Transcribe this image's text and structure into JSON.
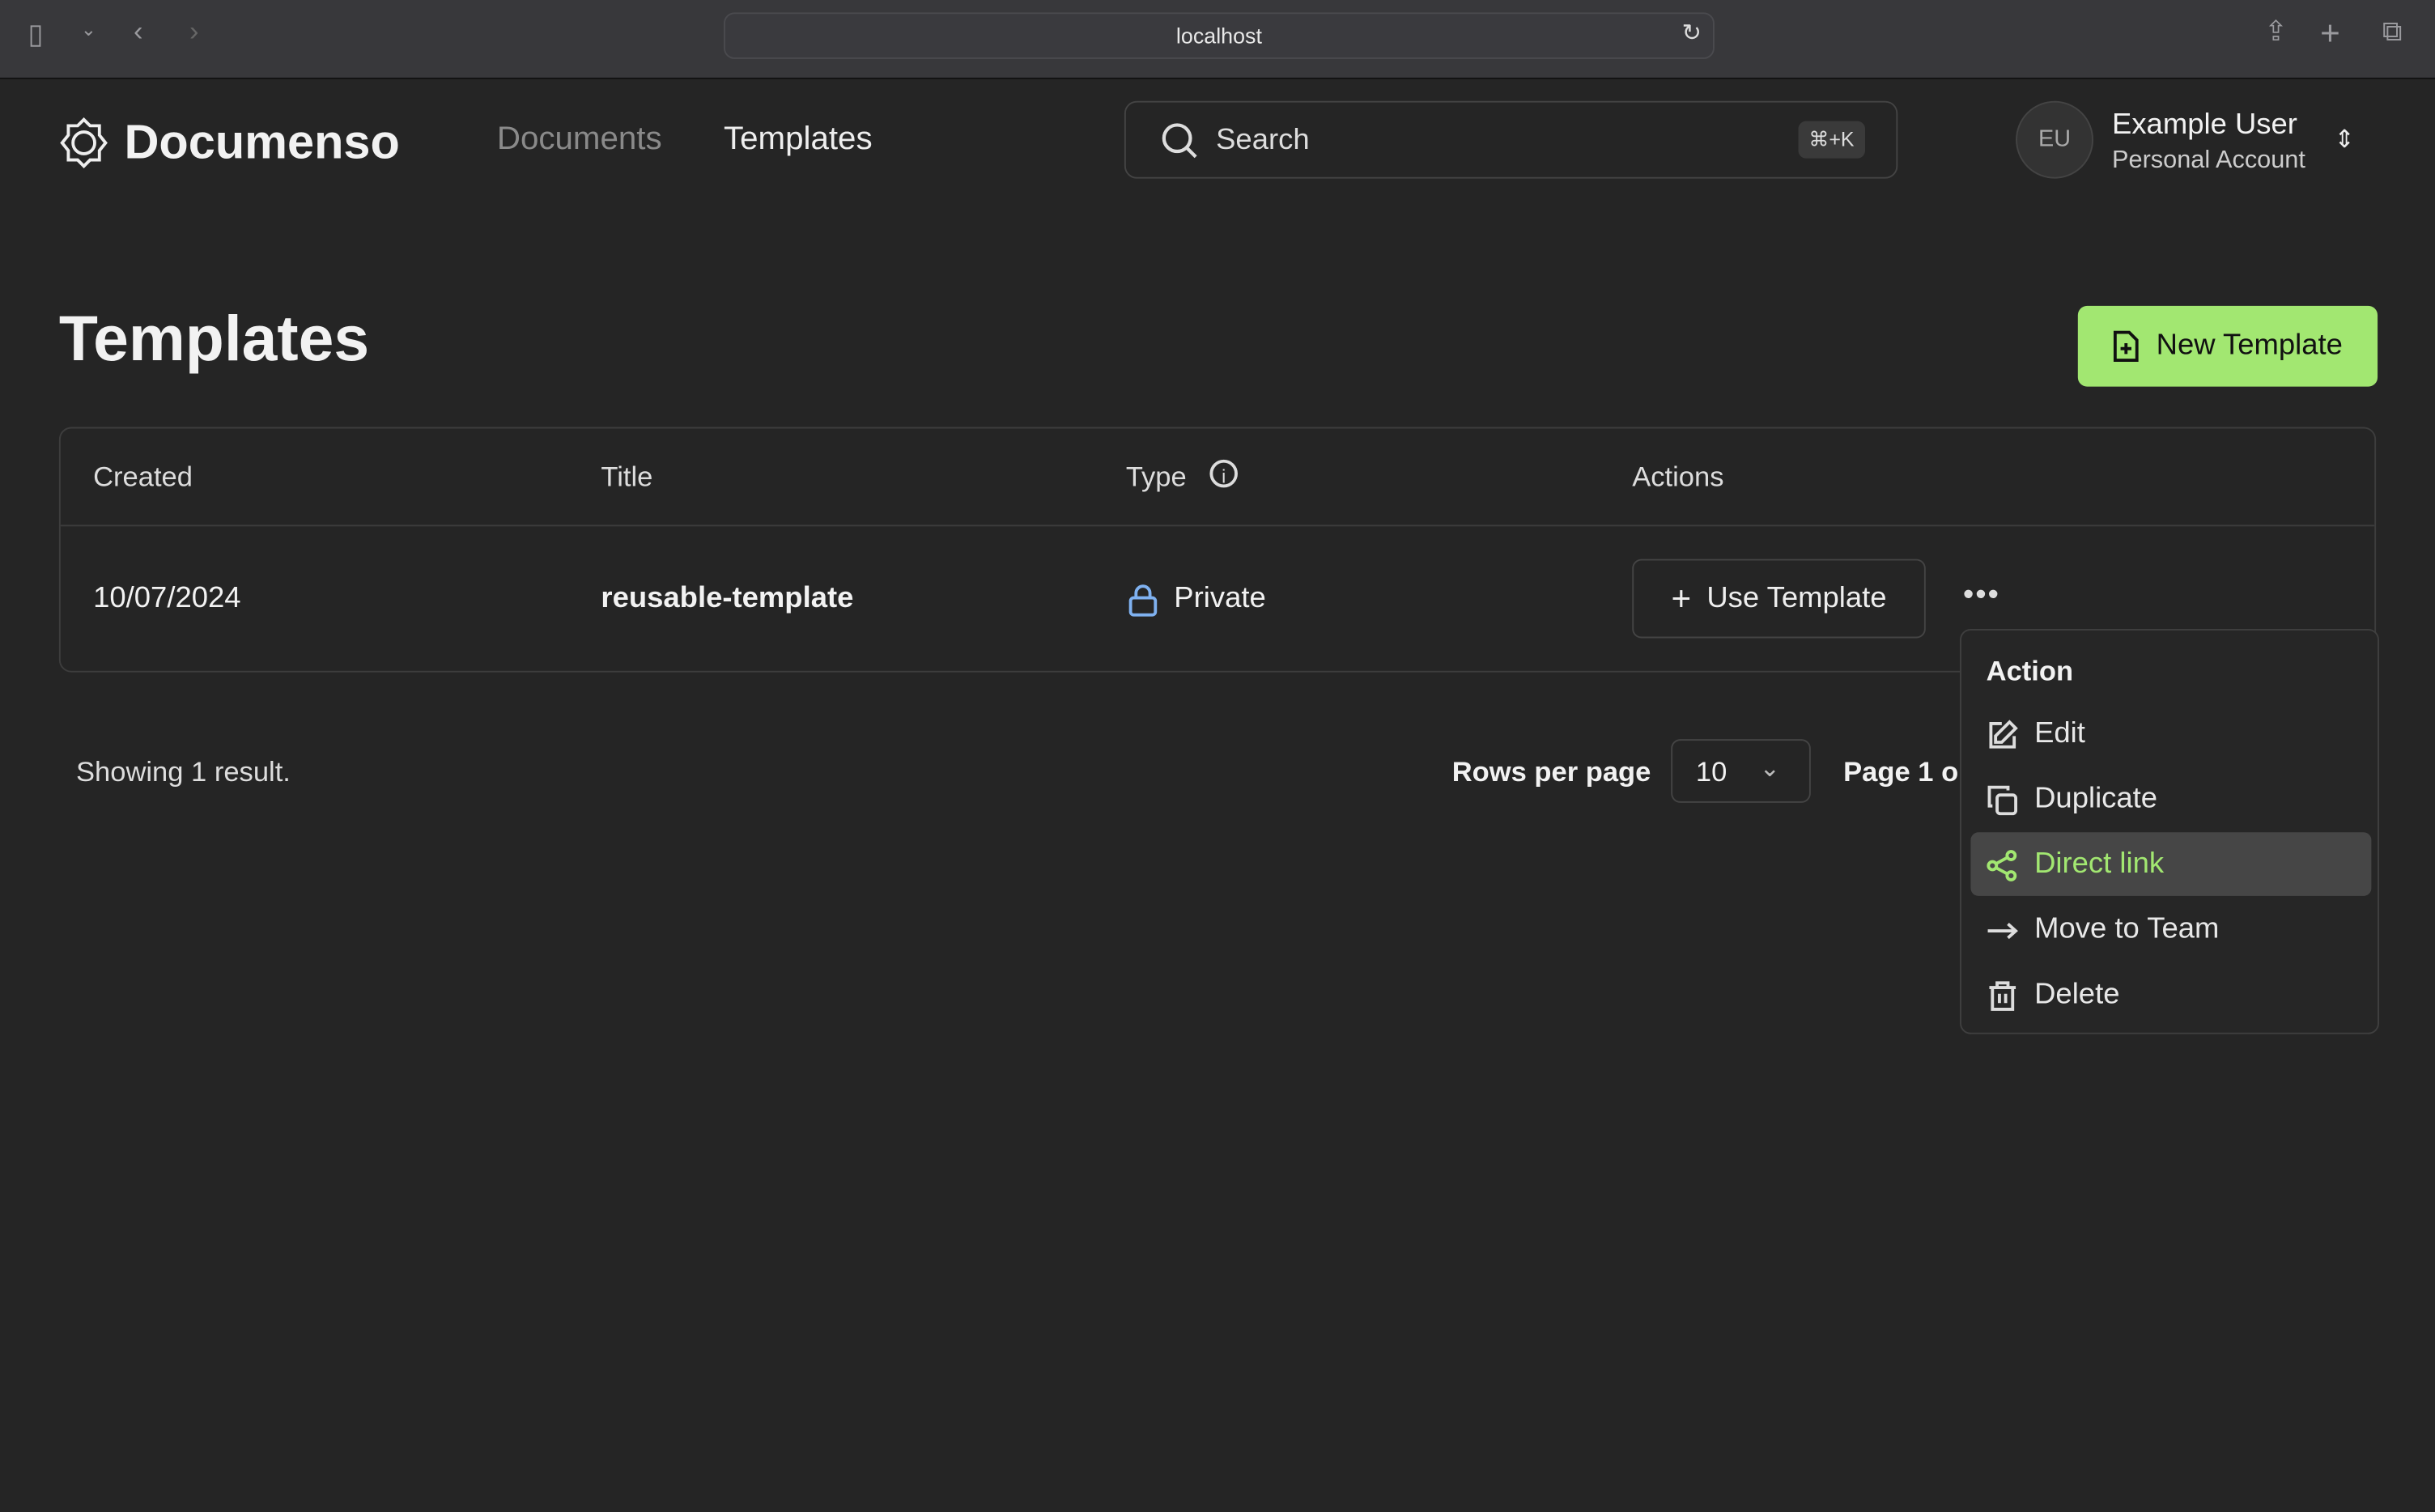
{
  "browser": {
    "url": "localhost"
  },
  "header": {
    "brand": "Documenso",
    "nav": [
      {
        "label": "Documents"
      },
      {
        "label": "Templates"
      }
    ],
    "search_placeholder": "Search",
    "search_shortcut": "⌘+K",
    "user": {
      "initials": "EU",
      "name": "Example User",
      "account": "Personal Account"
    }
  },
  "page": {
    "title": "Templates",
    "new_button": "New Template"
  },
  "table": {
    "columns": [
      "Created",
      "Title",
      "Type",
      "Actions"
    ],
    "rows": [
      {
        "created": "10/07/2024",
        "title": "reusable-template",
        "type": "Private",
        "action": "Use Template"
      }
    ]
  },
  "footer": {
    "showing": "Showing 1 result.",
    "rows_per_page_label": "Rows per page",
    "rows_per_page": "10",
    "page_label": "Page 1 o"
  },
  "menu": {
    "heading": "Action",
    "items": [
      {
        "label": "Edit",
        "icon": "edit-icon"
      },
      {
        "label": "Duplicate",
        "icon": "copy-icon"
      },
      {
        "label": "Direct link",
        "icon": "share-icon",
        "highlighted": true
      },
      {
        "label": "Move to Team",
        "icon": "arrow-right-icon"
      },
      {
        "label": "Delete",
        "icon": "trash-icon"
      }
    ]
  },
  "colors": {
    "accent": "#a2e771",
    "background": "#252525",
    "lock": "#7fb1f0"
  }
}
